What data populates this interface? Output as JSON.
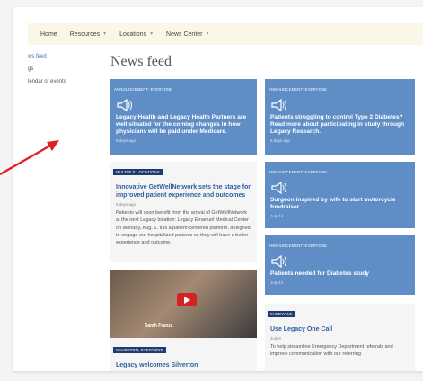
{
  "nav": {
    "home": "Home",
    "resources": "Resources",
    "locations": "Locations",
    "news_center": "News Center"
  },
  "sidebar": {
    "items": [
      "ws feed",
      "gs",
      "lendar of events"
    ]
  },
  "page_title": "News feed",
  "cards": {
    "c1": {
      "tag": "ANNOUNCEMENT: EVERYONE",
      "title": "Legacy Health and Legacy Health Partners are well situated for the coming changes in how physicians will be paid under Medicare.",
      "date": "6 days ago"
    },
    "c2": {
      "tag": "ANNOUNCEMENT: EVERYONE",
      "title": "Patients struggling to control Type 2 Diabetes? Read more about participating in study through Legacy Research.",
      "date": "6 days ago"
    },
    "c3": {
      "tag": "MULTIPLE LOCATIONS",
      "title": "Innovative GetWellNetwork sets the stage for improved patient experience and outcomes",
      "date": "6 days ago",
      "body": "Patients will soon benefit from the arrival of GetWellNetwork at the next Legacy location: Legacy Emanuel Medical Center on Monday, Aug. 1. It is a patient-centered platform, designed to engage our hospitalized patients so they will have a better experience and outcome."
    },
    "c4": {
      "tag": "ANNOUNCEMENT: EVERYONE",
      "title": "Surgeon inspired by wife to start motorcycle fundraiser",
      "date": "July 14"
    },
    "c5": {
      "tag": "ANNOUNCEMENT: EVERYONE",
      "title": "Patients needed for Diabetes study",
      "date": "July 12"
    },
    "c6": {
      "caption": "Sarah Franza",
      "tag": "SILVERTON, EVERYONE",
      "title": "Legacy welcomes Silverton"
    },
    "c7": {
      "tag": "EVERYONE",
      "title": "Use Legacy One Call",
      "date": "July 8",
      "body": "To help streamline Emergency Department referrals and improve communication with our referring"
    }
  },
  "colors": {
    "card_blue": "#5f8ec7",
    "tag_dark": "#1f3b6f",
    "link_blue": "#2d5f9e",
    "nav_bg": "#fbf7e6",
    "arrow_red": "#e02020",
    "play_red": "#d42323"
  },
  "icons": [
    "megaphone-icon",
    "chevron-down-icon",
    "play-icon",
    "red-arrow-annotation"
  ]
}
